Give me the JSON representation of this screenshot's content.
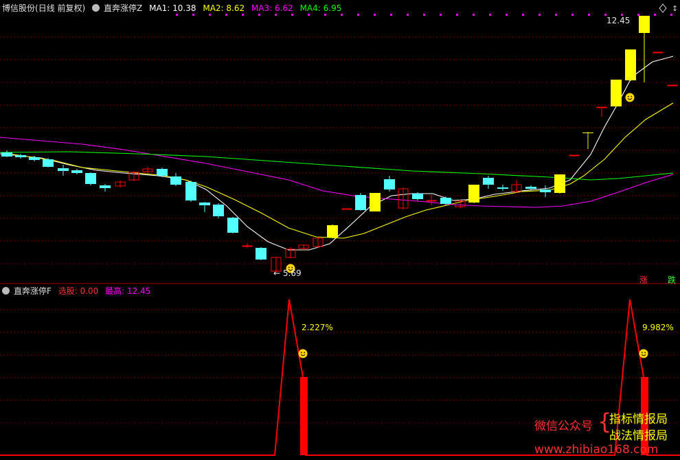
{
  "main_header": {
    "stock_name": "博信股份",
    "period": "(日线 前复权)",
    "indicator": "直奔涨停Z",
    "ma1": "MA1: 10.38",
    "ma2": "MA2: 8.62",
    "ma3": "MA3: 6.62",
    "ma4": "MA4: 6.95"
  },
  "main_chart": {
    "high_label": "12.45",
    "low_label": "← 5.69",
    "right_tags": [
      "涨",
      "跌"
    ]
  },
  "sub_header": {
    "indicator": "直奔涨停F",
    "select_label": "选股: 0.00",
    "max_label": "最高: 12.45"
  },
  "sub_chart": {
    "pct1": "2.227%",
    "pct2": "9.982%"
  },
  "watermark": {
    "wechat": "微信公众号",
    "brace": "{",
    "line1": "指标情报局",
    "line2": "战法情报局",
    "url": "www.zhibiao168.com"
  },
  "colors": {
    "ma1": "#ffffff",
    "ma2": "#ffff00",
    "ma3": "#ff00ff",
    "ma4": "#00ff00",
    "up": "#ff0000",
    "down": "#54ffff",
    "limit_up": "#ffff00"
  },
  "icons": [
    "circle-menu-icon",
    "diamond-icon",
    "smiley-icon"
  ]
}
